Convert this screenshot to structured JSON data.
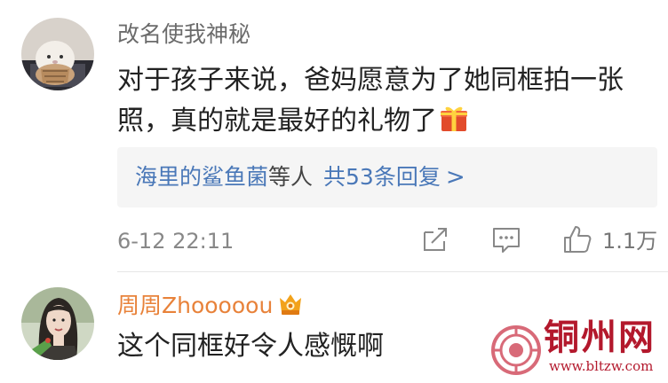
{
  "comments": [
    {
      "username": "改名使我神秘",
      "text": "对于孩子来说，爸妈愿意为了她同框拍一张照，真的就是最好的礼物了",
      "emoji": "gift-icon",
      "replies": {
        "first_replier": "海里的鲨鱼菌",
        "connector": "等人",
        "count_text": "共53条回复",
        "chevron": ">"
      },
      "timestamp": "6-12 22:11",
      "like_count": "1.1万"
    },
    {
      "username": "周周Zhooooou",
      "badge": "vip-crown-icon",
      "text": "这个同框好令人感慨啊"
    }
  ],
  "watermark": {
    "name": "铜州网",
    "url": "www.bltzw.com"
  },
  "colors": {
    "username_gray": "#6b6b6b",
    "username_orange": "#e8823a",
    "link_blue": "#4a78b8",
    "watermark_red": "#b3182c",
    "reply_bg": "#f5f5f5"
  }
}
